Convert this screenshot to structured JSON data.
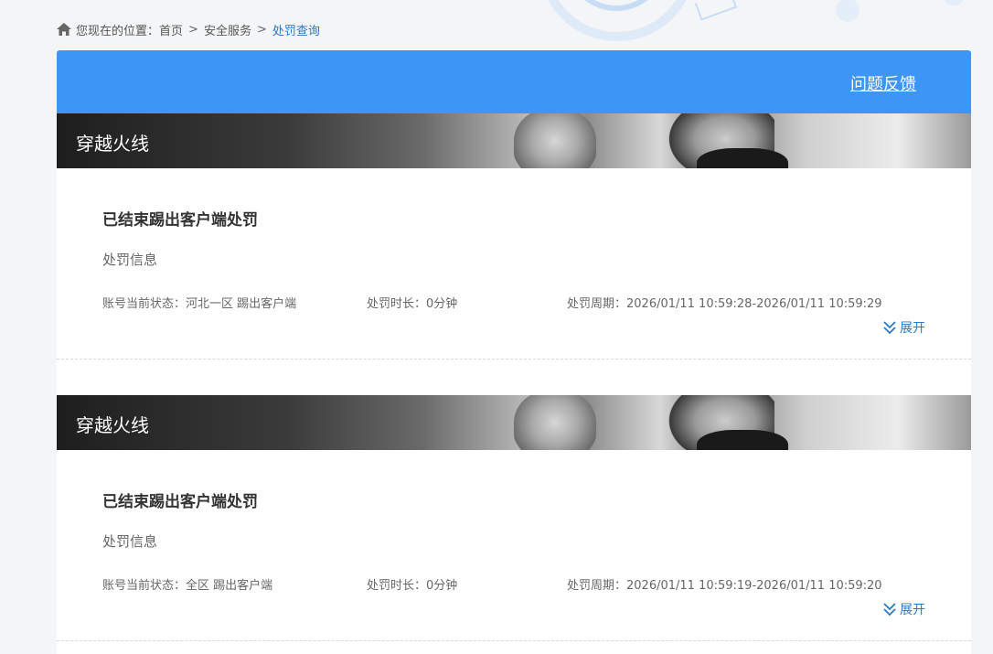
{
  "breadcrumb": {
    "prefix": "您现在的位置：",
    "items": [
      "首页",
      "安全服务"
    ],
    "separator": ">",
    "current": "处罚查询"
  },
  "topbar": {
    "feedback_label": "问题反馈"
  },
  "records": [
    {
      "game_name": "穿越火线",
      "title": "已结束踢出客户端处罚",
      "subtitle": "处罚信息",
      "status": "账号当前状态：河北一区 踢出客户端",
      "duration": "处罚时长：0分钟",
      "period": "处罚周期：2026/01/11 10:59:28-2026/01/11 10:59:29",
      "expand_label": "展开"
    },
    {
      "game_name": "穿越火线",
      "title": "已结束踢出客户端处罚",
      "subtitle": "处罚信息",
      "status": "账号当前状态：全区 踢出客户端",
      "duration": "处罚时长：0分钟",
      "period": "处罚周期：2026/01/11 10:59:19-2026/01/11 10:59:20",
      "expand_label": "展开"
    }
  ],
  "icons": {
    "home": "home-icon",
    "expand": "chevron-double-down-icon"
  },
  "colors": {
    "topbar": "#3d95f5",
    "link": "#2b78c5",
    "background": "#f4f5f7"
  }
}
